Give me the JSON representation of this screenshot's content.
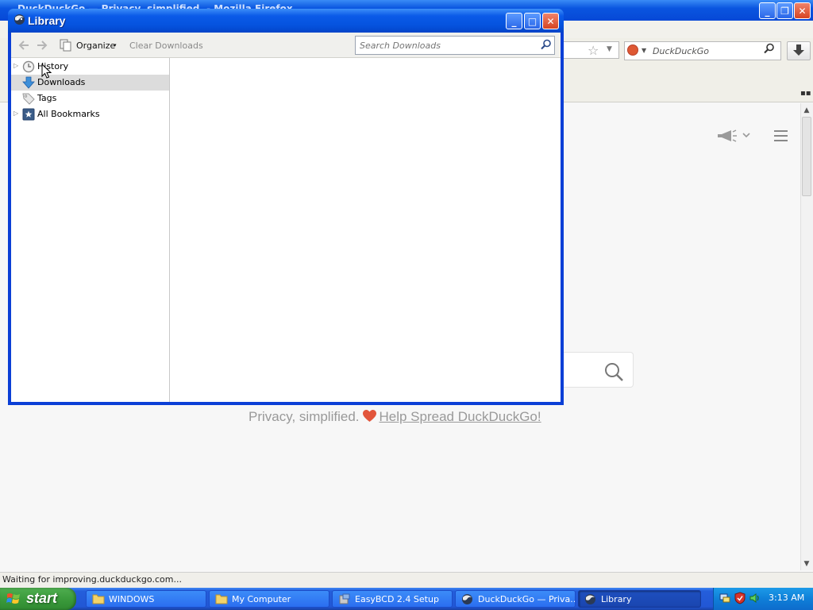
{
  "browser": {
    "window_title": "DuckDuckGo — Privacy, simplified. - Mozilla Firefox",
    "controls": {
      "minimize": "_",
      "restore": "❐",
      "close": "✕"
    },
    "search_box": {
      "placeholder": "DuckDuckGo"
    },
    "tagline": "Privacy, simplified.",
    "help_link": "Help Spread DuckDuckGo!",
    "status_text": "Waiting for improving.duckduckgo.com...",
    "scroll": {
      "up": "▲",
      "down": "▼"
    },
    "overflow": "▪▪",
    "dropdown_glyph": "▼",
    "star_glyph": "☆",
    "colors": {
      "ddg_orange": "#de5833",
      "heart": "#e2553b"
    }
  },
  "library": {
    "title": "Library",
    "controls": {
      "minimize": "_",
      "maximize": "□",
      "close": "✕"
    },
    "toolbar": {
      "organize_label": "Organize",
      "organize_caret": "▾",
      "clear_downloads_label": "Clear Downloads",
      "search_placeholder": "Search Downloads"
    },
    "tree": [
      {
        "label": "History",
        "twisty": "▷"
      },
      {
        "label": "Downloads",
        "twisty": ""
      },
      {
        "label": "Tags",
        "twisty": ""
      },
      {
        "label": "All Bookmarks",
        "twisty": "▷"
      }
    ],
    "selected_item": "Downloads"
  },
  "taskbar": {
    "start_label": "start",
    "tasks": [
      {
        "label": "WINDOWS",
        "icon": "folder-icon",
        "active": false
      },
      {
        "label": "My Computer",
        "icon": "folder-icon",
        "active": false
      },
      {
        "label": "EasyBCD 2.4 Setup",
        "icon": "installer-icon",
        "active": false
      },
      {
        "label": "DuckDuckGo — Priva...",
        "icon": "firefox-icon",
        "active": false
      },
      {
        "label": "Library",
        "icon": "firefox-icon",
        "active": true
      }
    ],
    "clock": "3:13 AM"
  }
}
